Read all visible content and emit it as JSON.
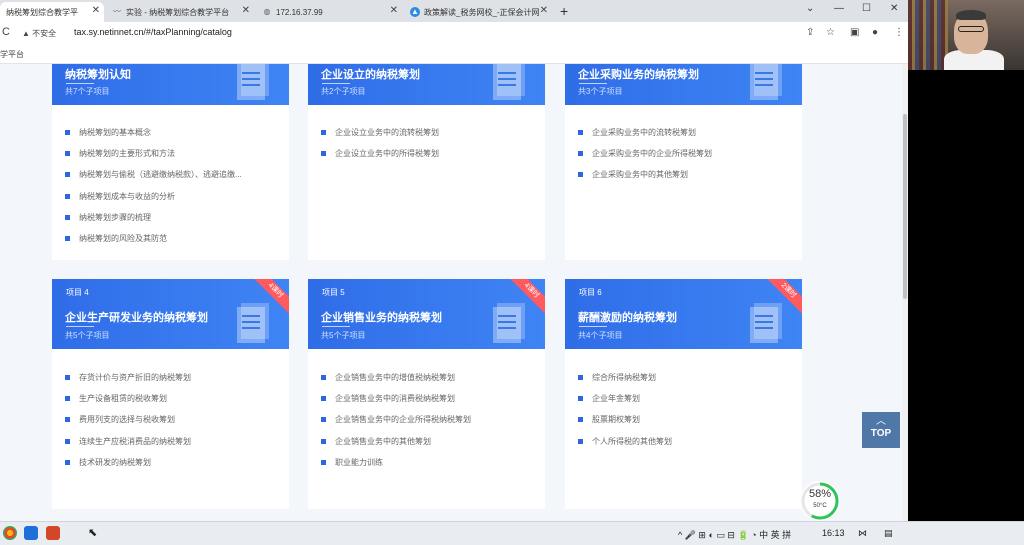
{
  "browser": {
    "tabs": [
      {
        "title": "纳税筹划综合教学平",
        "active": true
      },
      {
        "title": "实验 - 纳税筹划综合教学平台",
        "active": false
      },
      {
        "title": "172.16.37.99",
        "active": false
      },
      {
        "title": "政策解读_税务网校_-正保会计网",
        "active": false
      }
    ],
    "new_tab": "+",
    "window_controls": {
      "chevron": "⌄",
      "minimize": "—",
      "maximize": "☐",
      "close": "✕"
    },
    "address": {
      "reload": "C",
      "security_label": "▲ 不安全",
      "url": "tax.sy.netinnet.cn/#/taxPlanning/catalog"
    },
    "bookmark_label": "学平台"
  },
  "projects": [
    {
      "number": "",
      "title": "纳税筹划认知",
      "count": "共7个子项目",
      "hours": "",
      "items": [
        "纳税筹划的基本概念",
        "纳税筹划的主要形式和方法",
        "纳税筹划与偷税（逃避缴纳税款）、逃避追缴...",
        "纳税筹划成本与收益的分析",
        "纳税筹划步骤的梳理",
        "纳税筹划的风险及其防范"
      ]
    },
    {
      "number": "",
      "title": "企业设立的纳税筹划",
      "count": "共2个子项目",
      "hours": "",
      "items": [
        "企业设立业务中的流转税筹划",
        "企业设立业务中的所得税筹划"
      ]
    },
    {
      "number": "",
      "title": "企业采购业务的纳税筹划",
      "count": "共3个子项目",
      "hours": "",
      "items": [
        "企业采购业务中的流转税筹划",
        "企业采购业务中的企业所得税筹划",
        "企业采购业务中的其他筹划"
      ]
    },
    {
      "number": "项目 4",
      "title": "企业生产研发业务的纳税筹划",
      "count": "共5个子项目",
      "hours": "4课时",
      "items": [
        "存货计价与资产折旧的纳税筹划",
        "生产设备租赁的税收筹划",
        "费用列支的选择与税收筹划",
        "连续生产应税消费品的纳税筹划",
        "技术研发的纳税筹划"
      ]
    },
    {
      "number": "项目 5",
      "title": "企业销售业务的纳税筹划",
      "count": "共5个子项目",
      "hours": "4课时",
      "items": [
        "企业销售业务中的增值税纳税筹划",
        "企业销售业务中的消费税纳税筹划",
        "企业销售业务中的企业所得税纳税筹划",
        "企业销售业务中的其他筹划",
        "职业能力训练"
      ]
    },
    {
      "number": "项目 6",
      "title": "薪酬激励的纳税筹划",
      "count": "共4个子项目",
      "hours": "2课时",
      "items": [
        "综合所得纳税筹划",
        "企业年金筹划",
        "股票期权筹划",
        "个人所得税的其他筹划"
      ]
    }
  ],
  "top_button": {
    "arrow": "︿",
    "label": "TOP"
  },
  "perf_widget": {
    "percent": "58%",
    "temp": "50°C"
  },
  "taskbar": {
    "tray_icons": "^ 🎤 ⊞ ◐ ▭ ⊟ 🔋 ◔ 中 英 拼",
    "time": "16:13"
  },
  "colors": {
    "header_blue": "#3479ee",
    "bullet_blue": "#2e66e0",
    "ribbon_red": "#ff5a5f",
    "top_button": "#4f77a8"
  }
}
